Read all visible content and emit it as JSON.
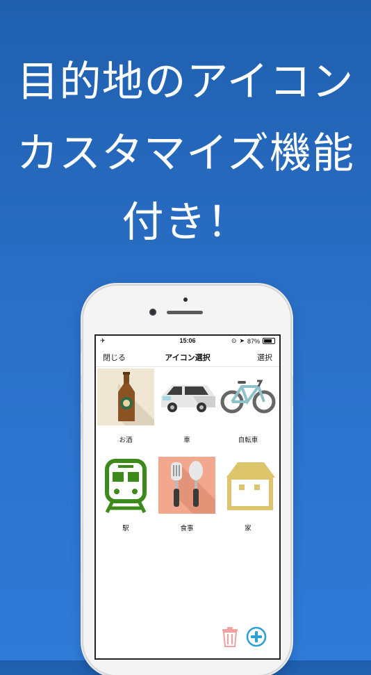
{
  "headline": {
    "line1": "目的地のアイコン",
    "line2": "カスタマイズ機能",
    "line3": "付き！"
  },
  "status_bar": {
    "time": "15:06",
    "battery": "87%",
    "left_icon": "airplane-icon"
  },
  "nav": {
    "close_label": "閉じる",
    "title": "アイコン選択",
    "select_label": "選択"
  },
  "icons": [
    {
      "label": "お酒",
      "icon": "beer-bottle-icon"
    },
    {
      "label": "車",
      "icon": "car-icon"
    },
    {
      "label": "自転車",
      "icon": "bicycle-icon"
    },
    {
      "label": "駅",
      "icon": "train-icon"
    },
    {
      "label": "食事",
      "icon": "utensils-icon"
    },
    {
      "label": "家",
      "icon": "house-icon"
    }
  ],
  "colors": {
    "background_top": "#1f5fae",
    "background_bottom": "#2f7bd8",
    "trash": "#f2a0a0",
    "add": "#2a9fd8"
  }
}
